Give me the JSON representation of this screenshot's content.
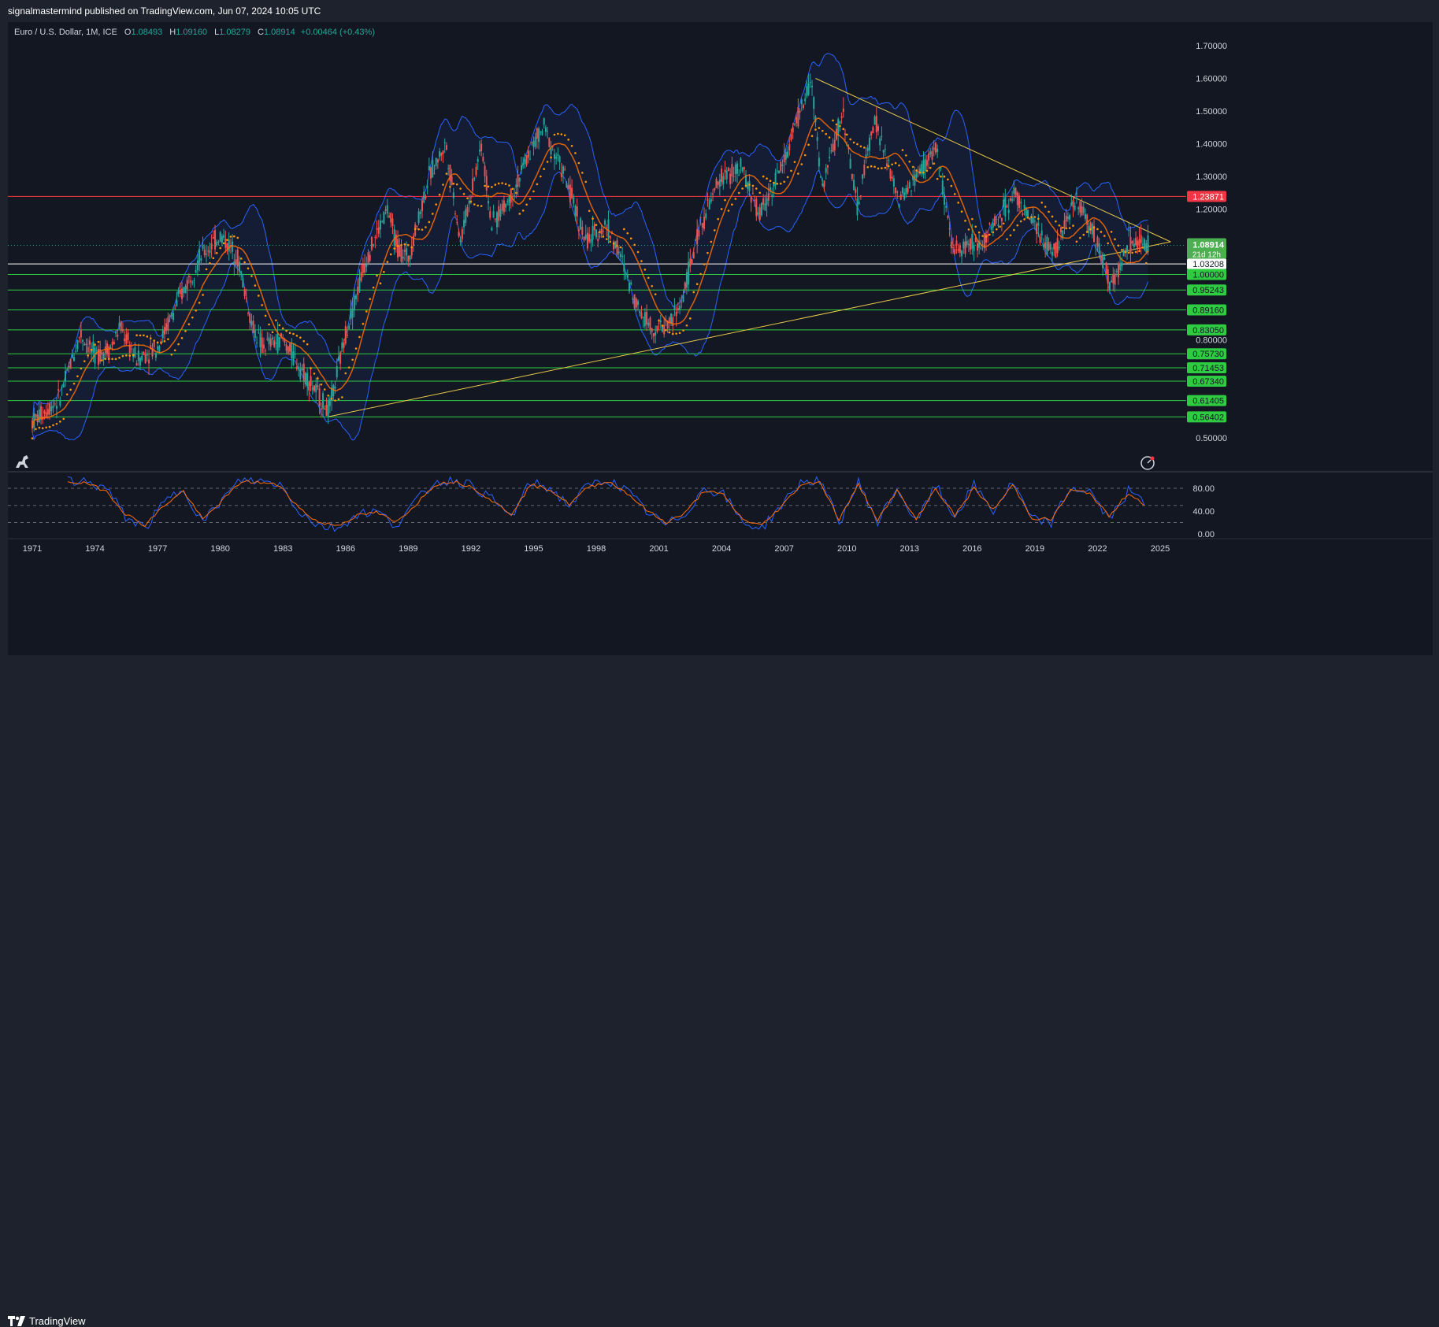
{
  "header": {
    "publisher_line": "signalmastermind published on TradingView.com, Jun 07, 2024 10:05 UTC"
  },
  "legend": {
    "symbol": "Euro / U.S. Dollar, 1M, ICE",
    "open_label": "O",
    "open": "1.08493",
    "high_label": "H",
    "high": "1.09160",
    "low_label": "L",
    "low": "1.08279",
    "close_label": "C",
    "close": "1.08914",
    "change": "+0.00464 (+0.43%)"
  },
  "colors": {
    "background": "#131722",
    "frame": "#1e222d",
    "up_candle": "#26a69a",
    "down_candle": "#ef5350",
    "bollinger": "#2962ff",
    "sar_dots": "#ff9800",
    "ma_line": "#ff6d00",
    "trendline": "#e6c84a",
    "support_lines": "#2ecc40",
    "resistance_line": "#f23645",
    "stoch_k": "#2962ff",
    "stoch_d": "#ff6d00"
  },
  "chart_data": [
    {
      "type": "candlestick",
      "title": "Euro / U.S. Dollar, 1M, ICE",
      "xlabel": "",
      "ylabel": "",
      "ylim": [
        0.45,
        1.75
      ],
      "grid": false,
      "x_ticks": [
        "1971",
        "1974",
        "1977",
        "1980",
        "1983",
        "1986",
        "1989",
        "1992",
        "1995",
        "1998",
        "2001",
        "2004",
        "2007",
        "2010",
        "2013",
        "2016",
        "2019",
        "2022",
        "2025"
      ],
      "y_ticks": [
        "1.70000",
        "1.60000",
        "1.50000",
        "1.40000",
        "1.30000",
        "1.20000",
        "0.80000",
        "0.50000"
      ],
      "price_path": [
        [
          1971.0,
          0.55
        ],
        [
          1972.3,
          0.62
        ],
        [
          1973.3,
          0.82
        ],
        [
          1974.0,
          0.75
        ],
        [
          1974.8,
          0.78
        ],
        [
          1975.2,
          0.84
        ],
        [
          1976.0,
          0.74
        ],
        [
          1977.0,
          0.78
        ],
        [
          1978.0,
          0.92
        ],
        [
          1979.0,
          1.05
        ],
        [
          1980.0,
          1.12
        ],
        [
          1980.8,
          1.06
        ],
        [
          1981.5,
          0.85
        ],
        [
          1982.0,
          0.78
        ],
        [
          1983.0,
          0.8
        ],
        [
          1984.0,
          0.7
        ],
        [
          1985.0,
          0.6
        ],
        [
          1985.2,
          0.58
        ],
        [
          1986.0,
          0.82
        ],
        [
          1987.0,
          1.05
        ],
        [
          1988.0,
          1.2
        ],
        [
          1988.5,
          1.08
        ],
        [
          1989.0,
          1.05
        ],
        [
          1990.0,
          1.3
        ],
        [
          1990.8,
          1.4
        ],
        [
          1991.5,
          1.1
        ],
        [
          1992.5,
          1.4
        ],
        [
          1993.0,
          1.15
        ],
        [
          1994.0,
          1.25
        ],
        [
          1995.0,
          1.4
        ],
        [
          1995.5,
          1.45
        ],
        [
          1996.5,
          1.3
        ],
        [
          1997.5,
          1.1
        ],
        [
          1998.5,
          1.15
        ],
        [
          1999.0,
          1.08
        ],
        [
          2000.0,
          0.9
        ],
        [
          2000.8,
          0.83
        ],
        [
          2001.5,
          0.85
        ],
        [
          2002.0,
          0.9
        ],
        [
          2003.0,
          1.15
        ],
        [
          2004.0,
          1.3
        ],
        [
          2005.0,
          1.32
        ],
        [
          2005.8,
          1.18
        ],
        [
          2007.0,
          1.35
        ],
        [
          2008.3,
          1.6
        ],
        [
          2008.8,
          1.26
        ],
        [
          2009.8,
          1.5
        ],
        [
          2010.5,
          1.2
        ],
        [
          2011.3,
          1.48
        ],
        [
          2012.5,
          1.22
        ],
        [
          2014.3,
          1.39
        ],
        [
          2015.0,
          1.08
        ],
        [
          2016.5,
          1.1
        ],
        [
          2018.0,
          1.25
        ],
        [
          2019.5,
          1.09
        ],
        [
          2020.0,
          1.08
        ],
        [
          2021.0,
          1.23
        ],
        [
          2021.8,
          1.13
        ],
        [
          2022.7,
          0.96
        ],
        [
          2023.5,
          1.1
        ],
        [
          2024.4,
          1.089
        ]
      ],
      "reference_lines": [
        {
          "label": "1.23871",
          "value": 1.23871,
          "color": "#f23645"
        },
        {
          "label": "1.03208",
          "value": 1.03208,
          "color": "#ffffff"
        },
        {
          "label": "1.00000",
          "value": 1.0,
          "color": "#2ecc40"
        },
        {
          "label": "0.95243",
          "value": 0.95243,
          "color": "#2ecc40"
        },
        {
          "label": "0.89160",
          "value": 0.8916,
          "color": "#2ecc40"
        },
        {
          "label": "0.83050",
          "value": 0.8305,
          "color": "#2ecc40"
        },
        {
          "label": "0.75730",
          "value": 0.7573,
          "color": "#2ecc40"
        },
        {
          "label": "0.71453",
          "value": 0.71453,
          "color": "#2ecc40"
        },
        {
          "label": "0.67340",
          "value": 0.6734,
          "color": "#2ecc40"
        },
        {
          "label": "0.61405",
          "value": 0.61405,
          "color": "#2ecc40"
        },
        {
          "label": "0.56402",
          "value": 0.56402,
          "color": "#2ecc40"
        }
      ],
      "last_price": {
        "label": "1.08914",
        "countdown": "21d 12h",
        "value": 1.08914
      },
      "trendlines": [
        {
          "from": [
            1985.2,
            0.565
          ],
          "to": [
            2025.5,
            1.1
          ]
        },
        {
          "from": [
            2008.5,
            1.6
          ],
          "to": [
            2025.5,
            1.1
          ]
        }
      ]
    },
    {
      "type": "line",
      "title": "",
      "ylim": [
        -5,
        100
      ],
      "y_ticks": [
        "80.00",
        "40.00",
        "0.00"
      ],
      "levels": [
        80,
        50,
        20
      ],
      "series": [
        {
          "values": [
            95,
            90,
            80,
            30,
            10,
            55,
            80,
            20,
            60,
            95,
            92,
            88,
            40,
            15,
            10,
            35,
            40,
            15,
            55,
            90,
            95,
            85,
            60,
            30,
            90,
            80,
            50,
            85,
            95,
            75,
            40,
            15,
            35,
            80,
            70,
            20,
            10,
            50,
            90,
            95,
            20,
            90,
            20,
            80,
            20,
            85,
            30,
            85,
            40,
            90,
            25,
            20,
            80,
            75,
            25,
            75,
            50
          ]
        },
        {
          "values": [
            92,
            88,
            75,
            35,
            15,
            50,
            75,
            25,
            58,
            92,
            90,
            85,
            45,
            20,
            15,
            32,
            38,
            20,
            50,
            86,
            92,
            82,
            58,
            35,
            86,
            78,
            52,
            82,
            92,
            72,
            42,
            20,
            36,
            76,
            68,
            25,
            15,
            48,
            86,
            92,
            25,
            86,
            25,
            76,
            25,
            80,
            32,
            80,
            42,
            86,
            28,
            25,
            76,
            72,
            30,
            72,
            48
          ]
        }
      ]
    }
  ],
  "footer": {
    "brand": "TradingView"
  }
}
